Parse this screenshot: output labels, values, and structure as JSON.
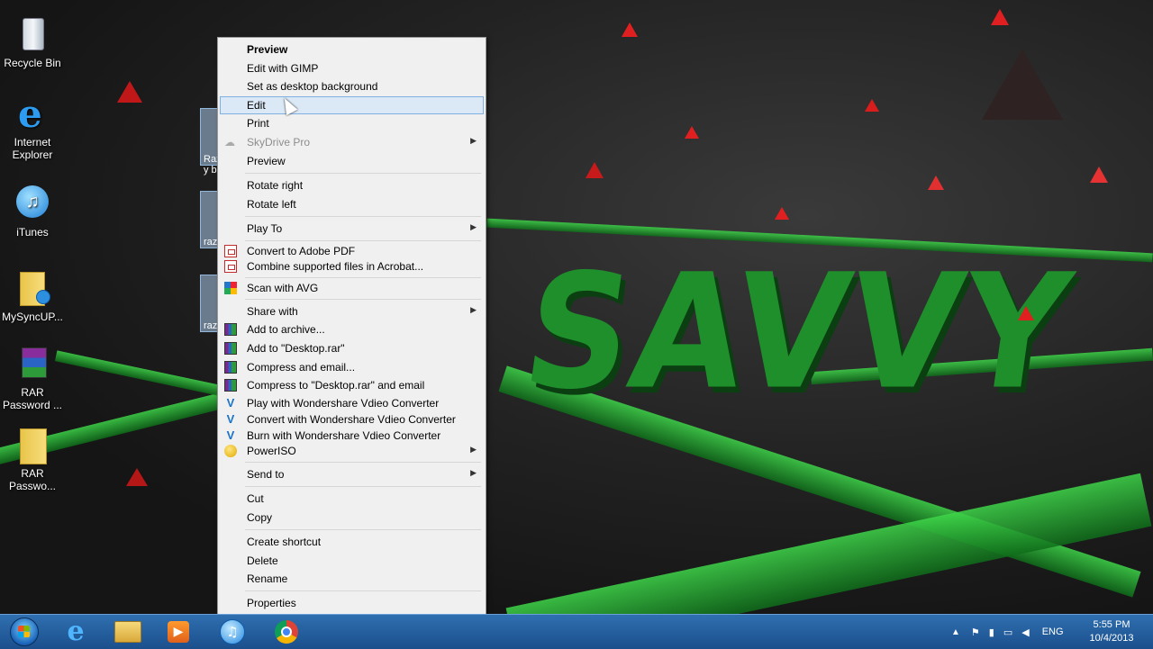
{
  "desktop": {
    "wallpaper_text": "SAVVY",
    "icons": [
      {
        "label": "Recycle Bin",
        "icon": "recycle-bin-icon"
      },
      {
        "label": "Internet\nExplorer",
        "icon": "internet-explorer-icon"
      },
      {
        "label": "iTunes",
        "icon": "itunes-icon"
      },
      {
        "label": "MySyncUP...",
        "icon": "folder-sync-icon"
      },
      {
        "label": "RAR\nPassword ...",
        "icon": "winrar-icon"
      },
      {
        "label": "RAR\nPasswo...",
        "icon": "folder-icon"
      }
    ],
    "partial_file_labels": [
      "Raz\ny b",
      "raz",
      "raz"
    ]
  },
  "context_menu": {
    "items": [
      {
        "label": "Preview",
        "bold": true
      },
      {
        "label": "Edit with GIMP"
      },
      {
        "label": "Set as desktop background"
      },
      {
        "label": "Edit",
        "highlighted": true
      },
      {
        "label": "Print"
      },
      {
        "label": "SkyDrive Pro",
        "disabled": true,
        "submenu": true,
        "icon": "skydrive-cloud-icon"
      },
      {
        "label": "Preview"
      },
      {
        "label": "Rotate right"
      },
      {
        "label": "Rotate left"
      },
      {
        "label": "Play To",
        "submenu": true
      },
      {
        "label": "Convert to Adobe PDF",
        "icon": "adobe-pdf-icon"
      },
      {
        "label": "Combine supported files in Acrobat...",
        "icon": "acrobat-combine-icon"
      },
      {
        "label": "Scan with AVG",
        "icon": "avg-icon"
      },
      {
        "label": "Share with",
        "submenu": true
      },
      {
        "label": "Add to archive...",
        "icon": "winrar-icon"
      },
      {
        "label": "Add to \"Desktop.rar\"",
        "icon": "winrar-icon"
      },
      {
        "label": "Compress and email...",
        "icon": "winrar-icon"
      },
      {
        "label": "Compress to \"Desktop.rar\" and email",
        "icon": "winrar-icon"
      },
      {
        "label": "Play with Wondershare Vdieo Converter",
        "icon": "wondershare-icon"
      },
      {
        "label": "Convert with Wondershare Vdieo Converter",
        "icon": "wondershare-icon"
      },
      {
        "label": "Burn with Wondershare Vdieo Converter",
        "icon": "wondershare-icon"
      },
      {
        "label": "PowerISO",
        "submenu": true,
        "icon": "poweriso-icon"
      },
      {
        "label": "Send to",
        "submenu": true
      },
      {
        "label": "Cut"
      },
      {
        "label": "Copy"
      },
      {
        "label": "Create shortcut"
      },
      {
        "label": "Delete"
      },
      {
        "label": "Rename"
      },
      {
        "label": "Properties"
      }
    ],
    "submenu_arrow": "▶"
  },
  "taskbar": {
    "pinned": [
      "start-orb-icon",
      "internet-explorer-icon",
      "file-explorer-icon",
      "media-player-icon",
      "itunes-icon",
      "chrome-icon"
    ],
    "tray": {
      "language": "ENG",
      "time": "5:55 PM",
      "date": "10/4/2013"
    }
  },
  "colors": {
    "menu_bg": "#f0f0f0",
    "menu_highlight": "#dbe8f6",
    "taskbar": "#1b4f8c",
    "wallpaper_green": "#1f8f2b",
    "wallpaper_red": "#e02020"
  }
}
